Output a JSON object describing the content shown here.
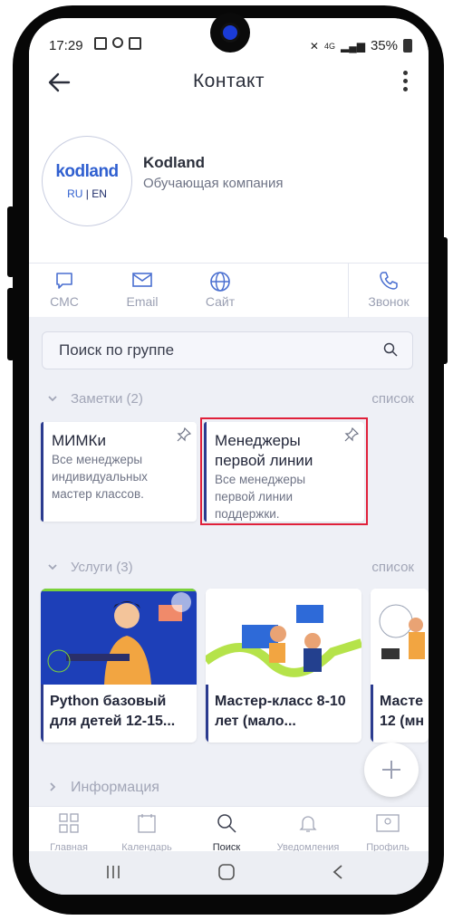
{
  "status_bar": {
    "time": "17:29",
    "battery": "35%",
    "network": "4G"
  },
  "header": {
    "title": "Контакт"
  },
  "profile": {
    "logo_word": "kodland",
    "logo_lang_ru": "RU",
    "logo_lang_sep": " | ",
    "logo_lang_en": "EN",
    "name": "Kodland",
    "description": "Обучающая компания"
  },
  "actions": [
    {
      "label": "СМС",
      "icon": "message-icon"
    },
    {
      "label": "Email",
      "icon": "mail-icon"
    },
    {
      "label": "Сайт",
      "icon": "globe-icon"
    },
    {
      "label": "Звонок",
      "icon": "phone-icon"
    }
  ],
  "search": {
    "placeholder": "Поиск по группе"
  },
  "notes_section": {
    "title": "Заметки (2)",
    "link": "список"
  },
  "notes": [
    {
      "title": "МИМКи",
      "text_lines": [
        "Все менеджеры",
        "индивидуальных",
        "мастер классов."
      ]
    },
    {
      "title_lines": [
        "Менеджеры",
        "первой линии"
      ],
      "text_lines": [
        "Все менеджеры",
        "первой линии",
        "поддержки."
      ]
    }
  ],
  "services_section": {
    "title": "Услуги (3)",
    "link": "список"
  },
  "services": [
    {
      "title_lines": [
        "Python базовый",
        "для детей 12-15..."
      ]
    },
    {
      "title_lines": [
        "Мастер-класс 8-10",
        "лет (мало..."
      ]
    },
    {
      "title_lines": [
        "Масте",
        "12 (мн"
      ]
    }
  ],
  "info_section": {
    "title": "Информация"
  },
  "bottom_nav": [
    {
      "label": "Главная",
      "icon": "grid-icon"
    },
    {
      "label": "Календарь",
      "icon": "calendar-icon"
    },
    {
      "label": "Поиск",
      "icon": "search-icon",
      "active": true
    },
    {
      "label": "Уведомления",
      "icon": "bell-icon"
    },
    {
      "label": "Профиль",
      "icon": "profile-icon"
    }
  ],
  "colors": {
    "accent": "#2b3b8f",
    "brand": "#2f5fd0",
    "highlight": "#e0203a",
    "muted_text": "#a2a6b7"
  }
}
